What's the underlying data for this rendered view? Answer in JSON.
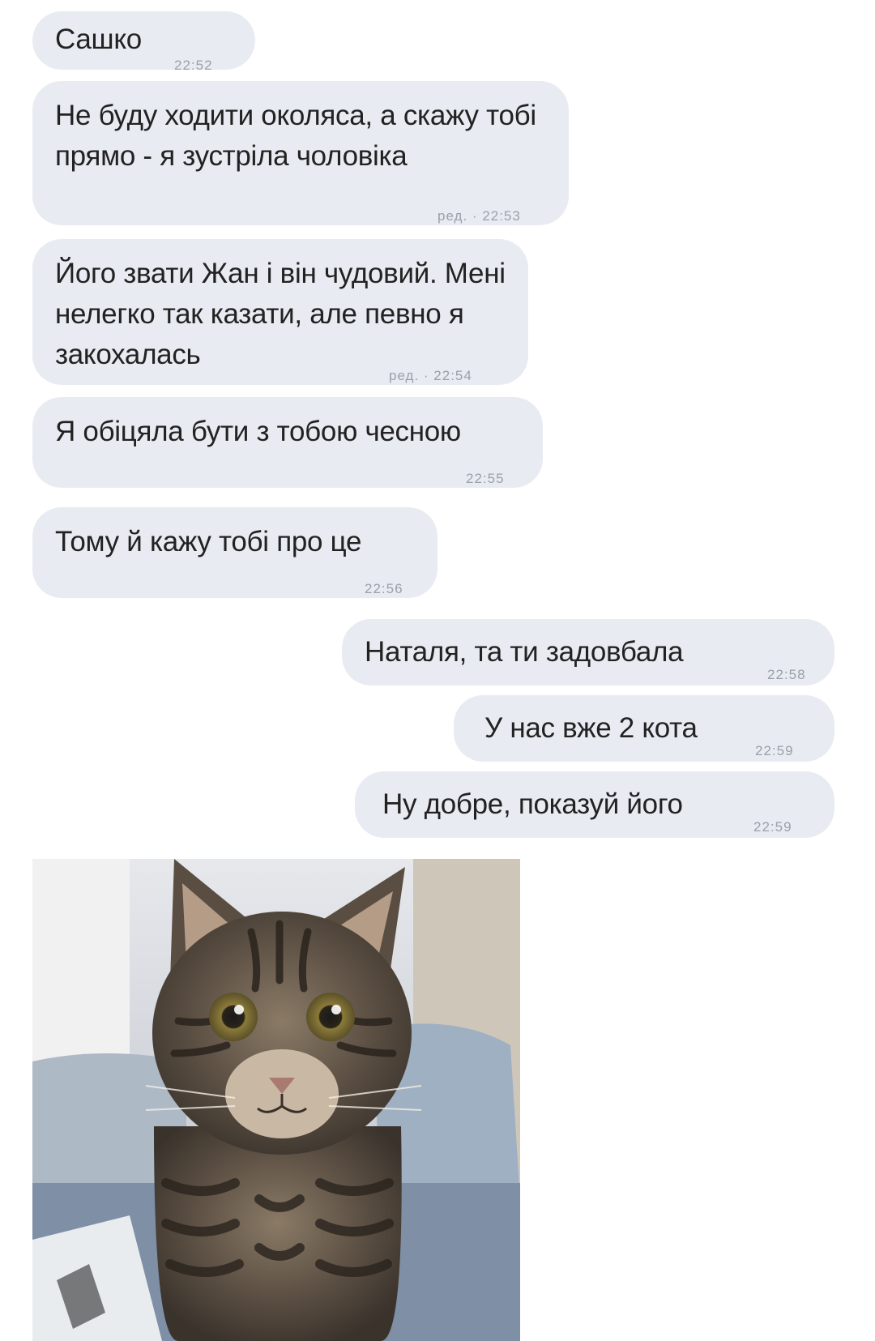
{
  "messages": [
    {
      "text": "Сашко",
      "meta": "22:52"
    },
    {
      "text": "Не буду ходити околяса, а скажу тобі прямо - я зустріла чоловіка",
      "meta": "ред. · 22:53"
    },
    {
      "text": "Його звати Жан і він чудовий. Мені нелегко так казати, але певно я закохалась",
      "meta": "ред. · 22:54"
    },
    {
      "text": "Я обіцяла бути з тобою чесною",
      "meta": "22:55"
    },
    {
      "text": "Тому й кажу тобі про це",
      "meta": "22:56"
    },
    {
      "text": "Наталя, та ти задовбала",
      "meta": "22:58"
    },
    {
      "text": "У нас вже 2 кота",
      "meta": "22:59"
    },
    {
      "text": "Ну добре, показуй його",
      "meta": "22:59"
    }
  ],
  "colors": {
    "bubble": "#e8ebf1",
    "time": "#9aa0aa",
    "background": "#ffffff"
  },
  "photo": {
    "subject": "tabby cat photo"
  }
}
